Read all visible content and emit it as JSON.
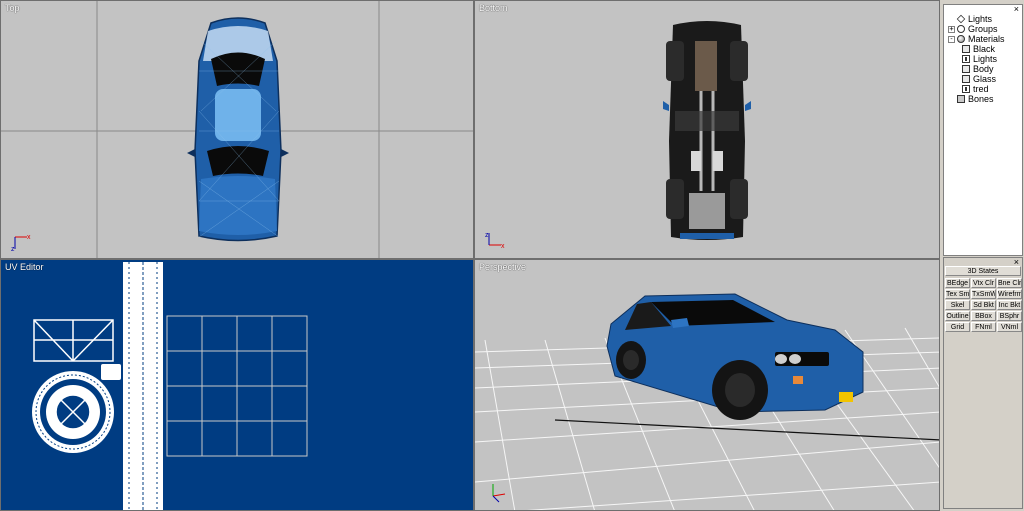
{
  "viewports": {
    "top": {
      "title": "Top"
    },
    "bottom": {
      "title": "Bottom"
    },
    "uv": {
      "title": "UV Editor"
    },
    "perspective": {
      "title": "Perspective"
    }
  },
  "tree": {
    "items": [
      {
        "label": "Lights",
        "expander": "",
        "icon": "lights"
      },
      {
        "label": "Groups",
        "expander": "+",
        "icon": "groups"
      },
      {
        "label": "Materials",
        "expander": "-",
        "icon": "materials"
      },
      {
        "label": "Black",
        "expander": "",
        "icon": "mat",
        "child": true
      },
      {
        "label": "Lights",
        "expander": "",
        "icon": "tex",
        "child": true
      },
      {
        "label": "Body",
        "expander": "",
        "icon": "mat",
        "child": true
      },
      {
        "label": "Glass",
        "expander": "",
        "icon": "mat",
        "child": true
      },
      {
        "label": "tred",
        "expander": "",
        "icon": "tex",
        "child": true
      },
      {
        "label": "Bones",
        "expander": "",
        "icon": "bones"
      }
    ],
    "close": "×"
  },
  "states": {
    "close": "×",
    "header": "3D States",
    "buttons": [
      [
        "BEdge",
        "Vtx Clr",
        "Bne Clr"
      ],
      [
        "Tex Sm",
        "TxSmWr",
        "Wirefrme"
      ],
      [
        "Skel",
        "Sd Bkt",
        "Inc Bkt"
      ],
      [
        "Outline",
        "BBox",
        "BSphr"
      ],
      [
        "Grid",
        "FNml",
        "VNml"
      ]
    ]
  },
  "colors": {
    "viewport_bg": "#c3c3c3",
    "uv_bg": "#003c82",
    "car_body": "#1f5fa8",
    "car_dark": "#0d2f5c"
  }
}
